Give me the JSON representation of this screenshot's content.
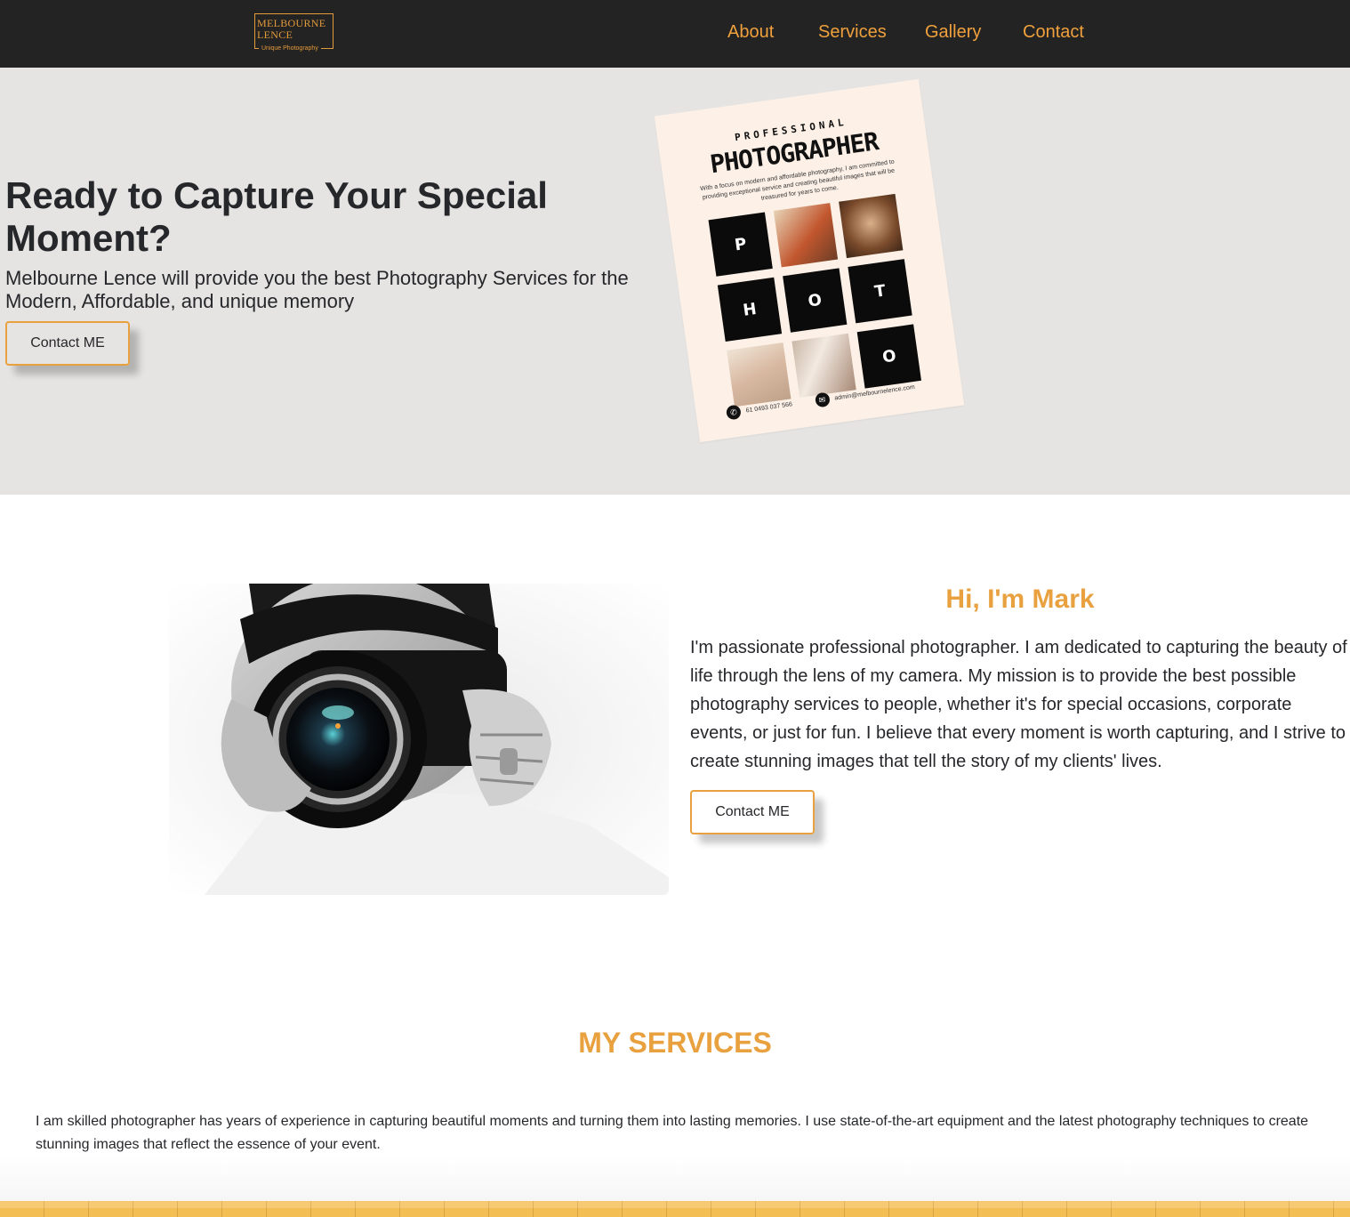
{
  "brand": {
    "logo_line1": "MELBOURNE",
    "logo_line2": "LENCE",
    "logo_tagline": "Unique Photography",
    "accent_color": "#f0a03c"
  },
  "nav": {
    "links": [
      "About",
      "Services",
      "Gallery",
      "Contact"
    ]
  },
  "hero": {
    "title": "Ready to Capture Your Special Moment?",
    "subtitle": "Melbourne Lence will provide you the best Photography Services for the Modern, Affordable, and unique memory",
    "cta": "Contact ME"
  },
  "poster": {
    "kicker": "PROFESSIONAL",
    "title": "PHOTOGRAPHER",
    "text": "With a focus on modern and affordable photography, I am committed to providing exceptional service and creating beautiful images that will be treasured for years to come.",
    "letters": [
      "P",
      "H",
      "O",
      "T",
      "O"
    ],
    "phone": "61 0493 037 566",
    "email": "admin@melbournelence.com",
    "icons": [
      "phone-icon",
      "mail-icon"
    ]
  },
  "about": {
    "title": "Hi, I'm Mark",
    "text": "I'm passionate professional photographer. I am dedicated to capturing the beauty of life through the lens of my camera. My mission is to provide the best possible photography services to people, whether it's for special occasions, corporate events, or just for fun. I believe that every moment is worth capturing, and I strive to create stunning images that tell the story of my clients' lives.",
    "cta": "Contact ME"
  },
  "services": {
    "title": "MY SERVICES",
    "text": "I am skilled photographer has years of experience in capturing beautiful moments and turning them into lasting memories. I use state-of-the-art equipment and the latest photography techniques to create stunning images that reflect the essence of your event."
  }
}
